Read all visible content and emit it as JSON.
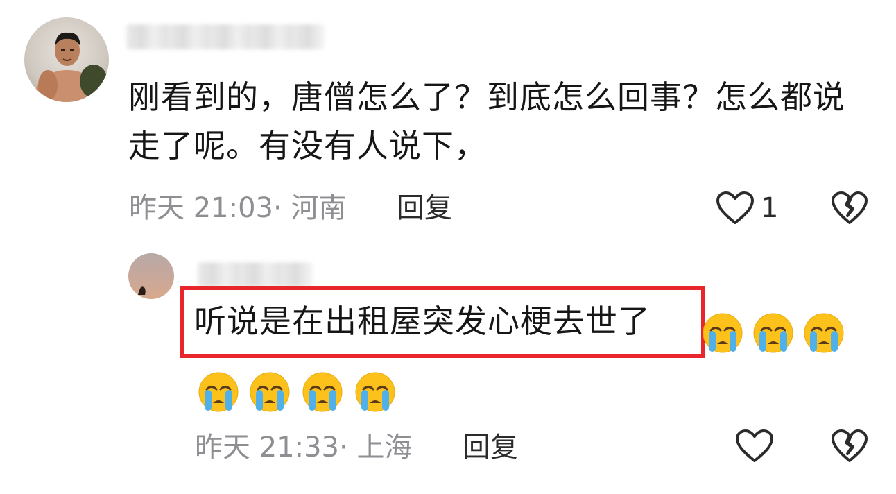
{
  "comments": [
    {
      "text": "刚看到的，唐僧怎么了？到底怎么回事？怎么都说走了呢。有没有人说下，",
      "timestamp": "昨天 21:03",
      "separator": "·",
      "location": "河南",
      "reply_label": "回复",
      "like_count": "1",
      "avatar_icon": "user-avatar-man",
      "like_icon": "heart-outline-icon",
      "dislike_icon": "broken-heart-icon"
    },
    {
      "text": "听说是在出租屋突发心梗去世了",
      "emoji_count": 7,
      "emoji_name": "loudly-crying-face",
      "timestamp": "昨天 21:33",
      "separator": "·",
      "location": "上海",
      "reply_label": "回复",
      "highlight_color": "#e8262c",
      "avatar_icon": "user-avatar-sunset",
      "like_icon": "heart-outline-icon",
      "dislike_icon": "broken-heart-icon"
    }
  ],
  "colors": {
    "meta_text": "#8e8e93",
    "body_text": "#161616",
    "highlight": "#e8262c"
  }
}
